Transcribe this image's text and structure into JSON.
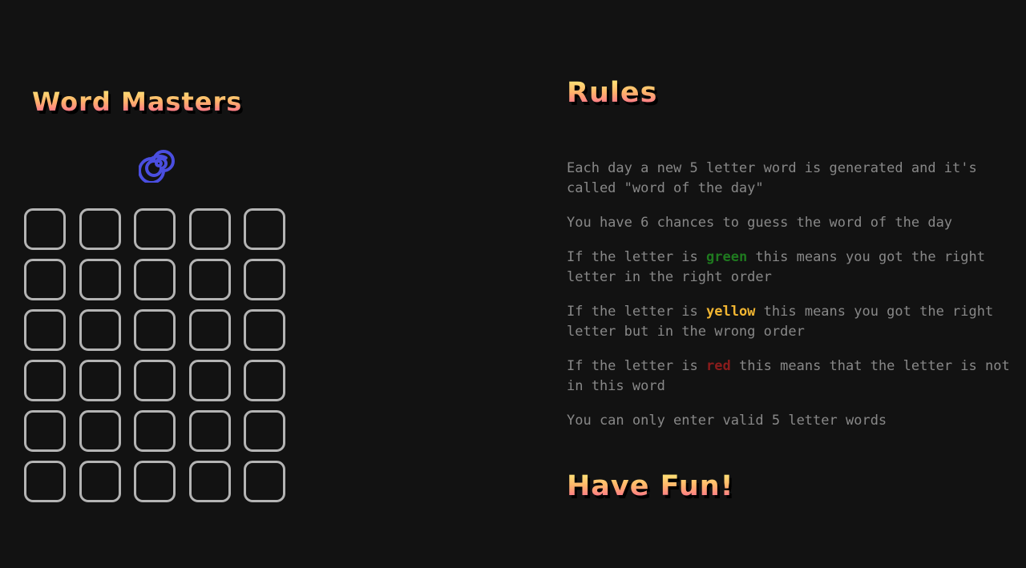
{
  "header": {
    "title": "Word Masters"
  },
  "loader": {
    "icon": "spiral-spinner-icon"
  },
  "board": {
    "rows": 6,
    "cols": 5,
    "tile_border_color": "#b4b4b4"
  },
  "rules": {
    "title": "Rules",
    "rule1": "Each day a new 5 letter word is generated and it's called \"word of the day\"",
    "rule2": "You have 6 chances to guess the word of the day",
    "rule3": {
      "before": "If the letter is ",
      "keyword": "green",
      "after": " this means you got the right letter in the right order"
    },
    "rule4": {
      "before": "If the letter is ",
      "keyword": "yellow",
      "after": " this means you got the right letter but in the wrong order"
    },
    "rule5": {
      "before": "If the letter is ",
      "keyword": "red",
      "after": " this means that the letter is not in this word"
    },
    "rule6": "You can only enter valid 5 letter words",
    "closing": "Have Fun!"
  },
  "colors": {
    "background": "#121212",
    "text": "#888888",
    "green": "#1f7a1f",
    "yellow": "#f2b632",
    "red": "#8c1c1c",
    "title_gradient": [
      "#fff27a",
      "#ffb46a",
      "#ff5a9a"
    ],
    "spinner": "#4a4ee0"
  }
}
